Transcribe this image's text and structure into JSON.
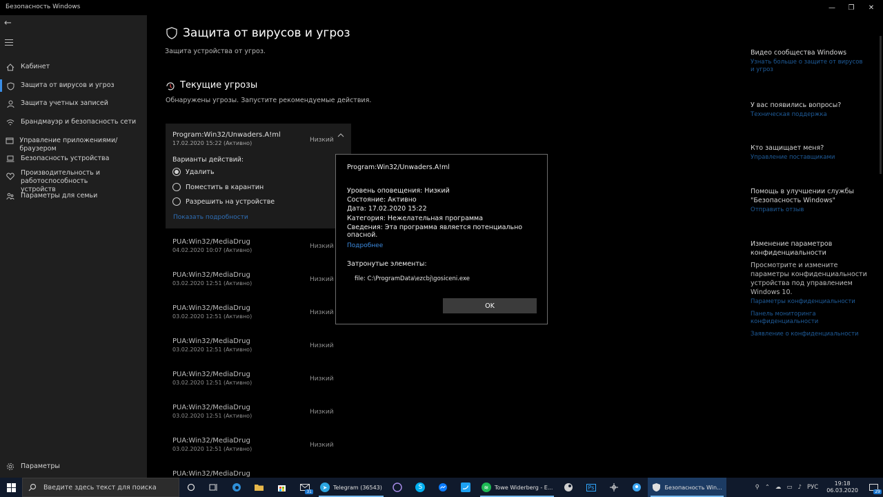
{
  "window": {
    "title": "Безопасность Windows",
    "minimize": "—",
    "maximize": "❐",
    "close": "✕"
  },
  "sidebar": {
    "items": [
      {
        "label": "Кабинет",
        "icon": "home-icon"
      },
      {
        "label": "Защита от вирусов и угроз",
        "icon": "shield-icon"
      },
      {
        "label": "Защита учетных записей",
        "icon": "person-icon"
      },
      {
        "label": "Брандмауэр и безопасность сети",
        "icon": "wifi-icon"
      },
      {
        "label": "Управление приложениями/браузером",
        "icon": "window-icon"
      },
      {
        "label": "Безопасность устройства",
        "icon": "laptop-icon"
      },
      {
        "label": "Производительность и работоспособность устройств",
        "icon": "heart-icon"
      },
      {
        "label": "Параметры для семьи",
        "icon": "family-icon"
      }
    ],
    "settings": "Параметры"
  },
  "main": {
    "title": "Защита от вирусов и угроз",
    "subtitle": "Защита устройства от угроз.",
    "section_title": "Текущие угрозы",
    "section_sub": "Обнаружены угрозы. Запустите рекомендуемые действия.",
    "expanded": {
      "name": "Program:Win32/Unwaders.A!ml",
      "date": "17.02.2020 15:22 (Активно)",
      "severity": "Низкий",
      "actions_label": "Варианты действий:",
      "options": [
        "Удалить",
        "Поместить в карантин",
        "Разрешить на устройстве"
      ],
      "show_details": "Показать подробности"
    },
    "threats": [
      {
        "name": "PUA:Win32/MediaDrug",
        "date": "04.02.2020 10:07 (Активно)",
        "severity": "Низкий"
      },
      {
        "name": "PUA:Win32/MediaDrug",
        "date": "03.02.2020 12:51 (Активно)",
        "severity": "Низкий"
      },
      {
        "name": "PUA:Win32/MediaDrug",
        "date": "03.02.2020 12:51 (Активно)",
        "severity": "Низкий"
      },
      {
        "name": "PUA:Win32/MediaDrug",
        "date": "03.02.2020 12:51 (Активно)",
        "severity": "Низкий"
      },
      {
        "name": "PUA:Win32/MediaDrug",
        "date": "03.02.2020 12:51 (Активно)",
        "severity": "Низкий"
      },
      {
        "name": "PUA:Win32/MediaDrug",
        "date": "03.02.2020 12:51 (Активно)",
        "severity": "Низкий"
      },
      {
        "name": "PUA:Win32/MediaDrug",
        "date": "03.02.2020 12:51 (Активно)",
        "severity": "Низкий"
      },
      {
        "name": "PUA:Win32/MediaDrug",
        "date": "",
        "severity": ""
      }
    ]
  },
  "right": {
    "community_title": "Видео сообщества Windows",
    "community_link": "Узнать больше о защите от вирусов и угроз",
    "questions_title": "У вас появились вопросы?",
    "questions_link": "Техническая поддержка",
    "who_title": "Кто защищает меня?",
    "who_link": "Управление поставщиками",
    "improve_title": "Помощь в улучшении службы \"Безопасность Windows\"",
    "improve_link": "Отправить отзыв",
    "privacy_title": "Изменение параметров конфиденциальности",
    "privacy_text": "Просмотрите и измените параметры конфиденциальности устройства под управлением Windows 10.",
    "privacy_links": [
      "Параметры конфиденциальности",
      "Панель мониторинга конфиденциальности",
      "Заявление о конфиденциальности"
    ]
  },
  "dialog": {
    "title": "Program:Win32/Unwaders.A!ml",
    "alert_level": "Уровень оповещения: Низкий",
    "state": "Состояние: Активно",
    "date": "Дата: 17.02.2020 15:22",
    "category": "Категория: Нежелательная программа",
    "details": "Сведения: Эта программа является потенциально опасной.",
    "more_link": "Подробнее",
    "affected_label": "Затронутые элементы:",
    "file": "file: C:\\ProgramData\\ezcbj\\gosiceni.exe",
    "ok": "OK"
  },
  "taskbar": {
    "search_placeholder": "Введите здесь текст для поиска",
    "mail_badge": "31",
    "telegram": "Telegram (36543)",
    "spotify": "Towe Widerberg - E...",
    "security": "Безопасность Win...",
    "lang": "РУС",
    "time": "19:18",
    "date": "06.03.2020",
    "notif_badge": "29"
  },
  "colors": {
    "accent": "#3a8ee6",
    "link": "#1f5c9a",
    "dialog_link": "#3c8be0",
    "sidebar_bg": "#1f1f1f",
    "taskbar_bg": "#101a2c"
  }
}
